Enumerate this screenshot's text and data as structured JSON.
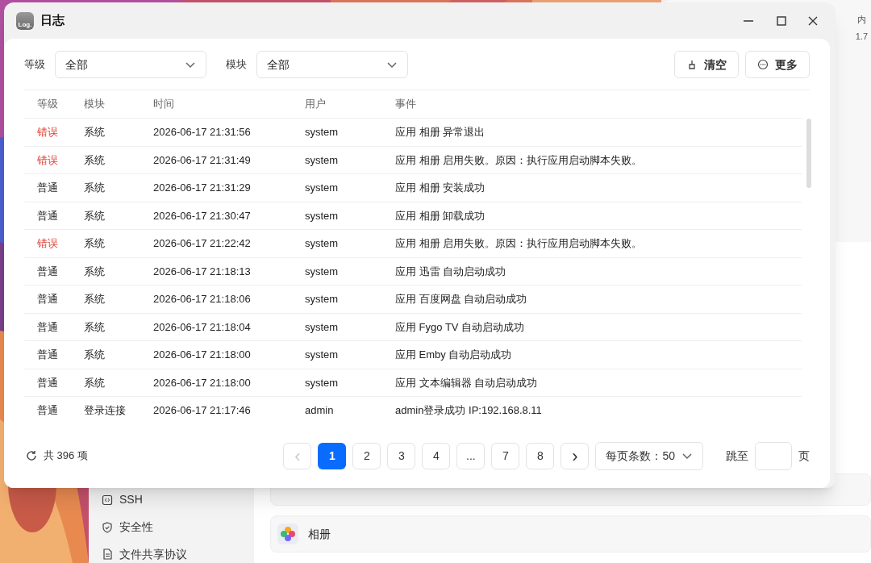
{
  "window": {
    "title": "日志",
    "icon_text": "Log."
  },
  "filters": [
    {
      "label": "等级",
      "value": "全部"
    },
    {
      "label": "模块",
      "value": "全部"
    }
  ],
  "actions": [
    {
      "kind": "clear",
      "label": "清空"
    },
    {
      "kind": "more",
      "label": "更多"
    }
  ],
  "table": {
    "columns": [
      "等级",
      "模块",
      "时间",
      "用户",
      "事件"
    ],
    "rows": [
      {
        "color": "#e0463a",
        "cells": [
          "错误",
          "系统",
          "2026-06-17 21:31:56",
          "system",
          "应用 相册 异常退出"
        ]
      },
      {
        "color": "#e0463a",
        "cells": [
          "错误",
          "系统",
          "2026-06-17 21:31:49",
          "system",
          "应用 相册 启用失败。原因：执行应用启动脚本失败。"
        ]
      },
      {
        "cells": [
          "普通",
          "系统",
          "2026-06-17 21:31:29",
          "system",
          "应用 相册 安装成功"
        ]
      },
      {
        "cells": [
          "普通",
          "系统",
          "2026-06-17 21:30:47",
          "system",
          "应用 相册 卸载成功"
        ]
      },
      {
        "color": "#e0463a",
        "cells": [
          "错误",
          "系统",
          "2026-06-17 21:22:42",
          "system",
          "应用 相册 启用失败。原因：执行应用启动脚本失败。"
        ]
      },
      {
        "cells": [
          "普通",
          "系统",
          "2026-06-17 21:18:13",
          "system",
          "应用 迅雷 自动启动成功"
        ]
      },
      {
        "cells": [
          "普通",
          "系统",
          "2026-06-17 21:18:06",
          "system",
          "应用 百度网盘 自动启动成功"
        ]
      },
      {
        "cells": [
          "普通",
          "系统",
          "2026-06-17 21:18:04",
          "system",
          "应用 Fygo TV 自动启动成功"
        ]
      },
      {
        "cells": [
          "普通",
          "系统",
          "2026-06-17 21:18:00",
          "system",
          "应用 Emby 自动启动成功"
        ]
      },
      {
        "cells": [
          "普通",
          "系统",
          "2026-06-17 21:18:00",
          "system",
          "应用 文本编辑器 自动启动成功"
        ]
      },
      {
        "cells": [
          "普通",
          "登录连接",
          "2026-06-17 21:17:46",
          "admin",
          "admin登录成功 IP:192.168.8.11"
        ]
      }
    ]
  },
  "footer": {
    "total": "共 396 项",
    "prev": {
      "label": "‹",
      "disabled": true
    },
    "pages": [
      {
        "label": "1",
        "selected": true
      },
      {
        "label": "2",
        "selected": false
      },
      {
        "label": "3",
        "selected": false
      },
      {
        "label": "4",
        "selected": false
      },
      {
        "label": "...",
        "selected": false
      },
      {
        "label": "7",
        "selected": false
      },
      {
        "label": "8",
        "selected": false
      }
    ],
    "next": {
      "label": "›",
      "disabled": false
    },
    "page_size": "每页条数：50",
    "jump_label": "跳至",
    "jump_unit": "页"
  },
  "background": {
    "widget_texts": [
      "内",
      "1.7"
    ],
    "sidebar": [
      {
        "kind": "ssh",
        "label": "SSH"
      },
      {
        "kind": "shield",
        "label": "安全性"
      },
      {
        "kind": "doc",
        "label": "文件共享协议"
      }
    ],
    "apps": [
      {
        "label": "相册"
      }
    ]
  }
}
